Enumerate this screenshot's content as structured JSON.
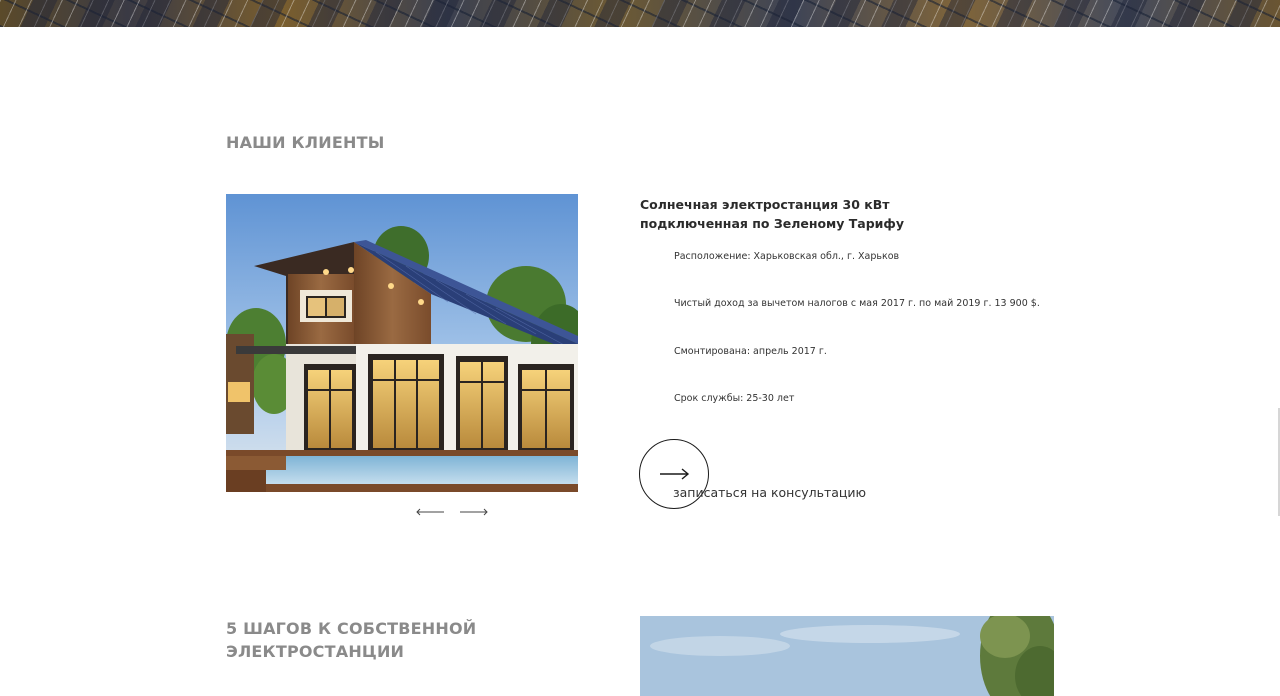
{
  "clients": {
    "title": "НАШИ КЛИЕНТЫ",
    "project": {
      "title": "Солнечная электростанция 30 кВт подключенная по Зеленому Тарифу",
      "details": [
        "Расположение: Харьковская обл., г. Харьков",
        "Чистый доход за вычетом налогов с мая 2017 г. по май 2019 г. 13 900 $.",
        "Смонтирована: апрель 2017 г.",
        "Срок службы: 25-30 лет"
      ]
    },
    "cta_label": "записаться на консультацию"
  },
  "steps": {
    "title": "5 ШАГОВ К СОБСТВЕННОЙ ЭЛЕКТРОСТАНЦИИ"
  },
  "icons": {
    "prev": "arrow-left-icon",
    "next": "arrow-right-icon",
    "cta": "arrow-right-icon"
  }
}
